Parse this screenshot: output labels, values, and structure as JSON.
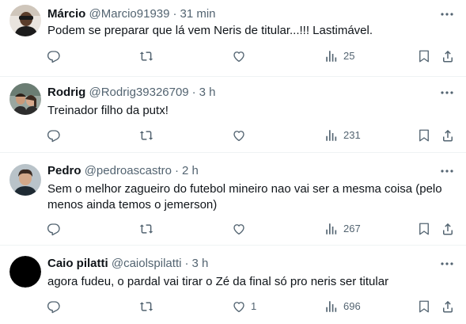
{
  "tweets": [
    {
      "name": "Márcio",
      "handle": "@Marcio91939",
      "separator": "·",
      "time": "31 min",
      "text": "Podem se preparar que lá vem Neris de titular...!!! Lastimável.",
      "reply_count": "",
      "retweet_count": "",
      "like_count": "",
      "views": "25"
    },
    {
      "name": "Rodrig",
      "handle": "@Rodrig39326709",
      "separator": "·",
      "time": "3 h",
      "text": "Treinador filho da putx!",
      "reply_count": "",
      "retweet_count": "",
      "like_count": "",
      "views": "231"
    },
    {
      "name": "Pedro",
      "handle": "@pedroascastro",
      "separator": "·",
      "time": "2 h",
      "text": "Sem o melhor zagueiro do futebol mineiro nao vai ser a mesma coisa (pelo menos ainda temos o jemerson)",
      "reply_count": "",
      "retweet_count": "",
      "like_count": "",
      "views": "267"
    },
    {
      "name": "Caio pilatti",
      "handle": "@caiolspilatti",
      "separator": "·",
      "time": "3 h",
      "text": "agora fudeu, o pardal vai tirar o Zé da final só pro neris ser titular",
      "reply_count": "",
      "retweet_count": "",
      "like_count": "1",
      "views": "696"
    }
  ],
  "colors": {
    "text_primary": "#0f1419",
    "text_secondary": "#536471",
    "divider": "#eff3f4",
    "background": "#ffffff"
  },
  "icons": [
    "reply-icon",
    "retweet-icon",
    "like-icon",
    "views-icon",
    "bookmark-icon",
    "share-icon",
    "more-icon"
  ]
}
